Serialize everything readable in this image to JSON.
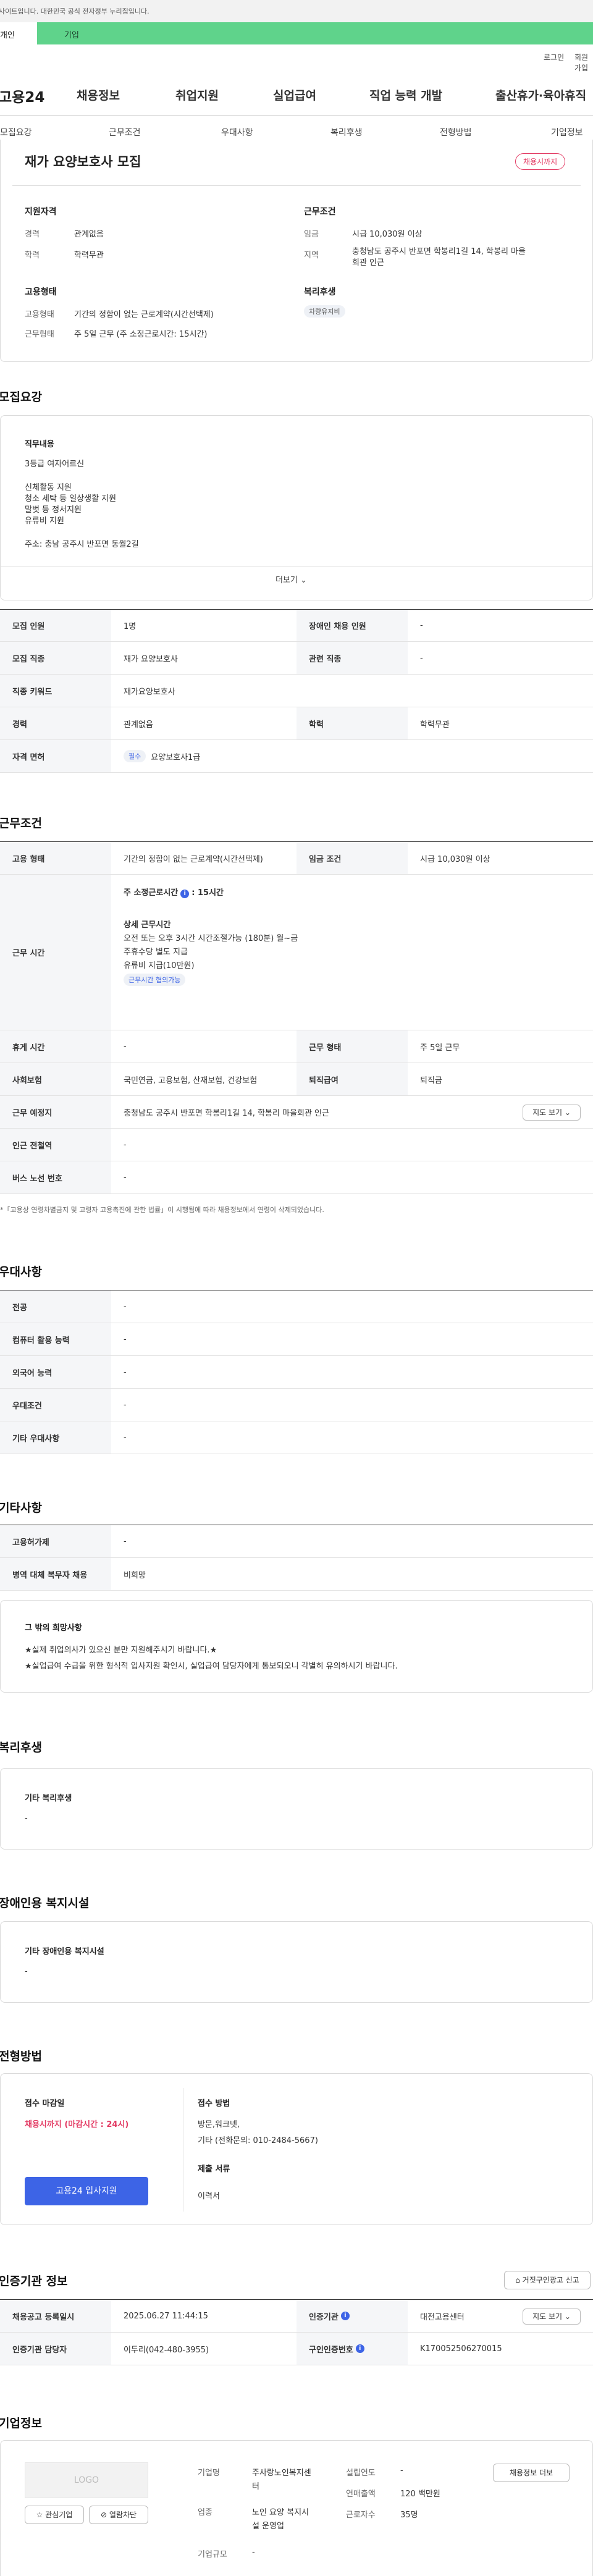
{
  "gov_notice": "사이트입니다. 대한민국 공식 전자정부 누리집입니다.",
  "tabs": {
    "personal": "개인",
    "corporate": "기업"
  },
  "util": {
    "login": "로그인",
    "signup": "회원가입"
  },
  "logo": "고용24",
  "gnb": [
    "채용정보",
    "취업지원",
    "실업급여",
    "직업 능력 개발",
    "출산휴가·육아휴직"
  ],
  "tabnav": [
    "모집요강",
    "근무조건",
    "우대사항",
    "복리후생",
    "전형방법",
    "기업정보"
  ],
  "summary": {
    "title": "재가 요양보호사 모집",
    "status_badge": "채용시까지",
    "qualification": {
      "heading": "지원자격",
      "career_label": "경력",
      "career_value": "관계없음",
      "edu_label": "학력",
      "edu_value": "학력무관"
    },
    "conditions": {
      "heading": "근무조건",
      "wage_label": "임금",
      "wage_value": "시급 10,030원 이상",
      "region_label": "지역",
      "region_value_1": "충청남도 공주시 반포면 학봉리1길 14, 학봉리 마을",
      "region_value_2": "회관 인근"
    },
    "employment": {
      "heading": "고용형태",
      "type_label": "고용형태",
      "type_value": "기간의 정함이 없는 근로계약(시간선택제)",
      "shift_label": "근무형태",
      "shift_value": "주 5일 근무 (주 소정근로시간: 15시간)"
    },
    "welfare": {
      "heading": "복리후생",
      "badge": "차량유지비"
    }
  },
  "recruit": {
    "section_title": "모집요강",
    "job_heading": "직무내용",
    "job_lines": [
      "3등급 여자어르신",
      "",
      "신체활동 지원",
      "청소 세탁 등 일상생활 지원",
      "말벗 등 정서지원",
      "유류비 지원",
      "",
      "주소: 충남 공주시 반포면 동월2길"
    ],
    "more_label": "더보기",
    "rows": [
      {
        "th1": "모집 인원",
        "td1": "1명",
        "th2": "장애인 채용 인원",
        "td2": "-"
      },
      {
        "th1": "모집 직종",
        "td1": "재가 요양보호사",
        "th2": "관련 직종",
        "td2": "-"
      },
      {
        "th1": "직종 키워드",
        "td1": "재가요양보호사"
      },
      {
        "th1": "경력",
        "td1": "관계없음",
        "th2": "학력",
        "td2": "학력무관"
      },
      {
        "th1": "자격 면허",
        "tag": "필수",
        "td1": "요양보호사1급"
      }
    ]
  },
  "conditions": {
    "section_title": "근무조건",
    "employ_type_th": "고용 형태",
    "employ_type_td": "기간의 정함이 없는 근로계약(시간선택제)",
    "wage_th": "임금 조건",
    "wage_td": "시급 10,030원 이상",
    "hours_th": "근무 시간",
    "hours_weekly": "주 소정근로시간",
    "hours_weekly_value": ": 15시간",
    "hours_detail_heading": "상세 근무시간",
    "hours_detail_lines": [
      "오전 또는 오후 3시간 시간조절가능 (180분) 월~금",
      "주휴수당 별도 지급",
      "유류비 지급(10만원)"
    ],
    "hours_tag": "근무시간 협의가능",
    "rows": [
      {
        "th1": "휴게 시간",
        "td1": "-",
        "th2": "근무 형태",
        "td2": "주 5일 근무"
      },
      {
        "th1": "사회보험",
        "td1": "국민연금, 고용보험, 산재보험, 건강보험",
        "th2": "퇴직급여",
        "td2": "퇴직금"
      },
      {
        "th1": "근무 예정지",
        "td1": "충청남도 공주시 반포면 학봉리1길 14, 학봉리 마을회관 인근",
        "btn": "지도 보기"
      },
      {
        "th1": "인근 전철역",
        "td1": "-"
      },
      {
        "th1": "버스 노선 번호",
        "td1": "-"
      }
    ],
    "footnote": "*「고용상 연령차별금지 및 고령자 고용촉진에 관한 법률」이 시행됨에 따라 채용정보에서 연령이 삭제되었습니다."
  },
  "preference": {
    "section_title": "우대사항",
    "rows": [
      {
        "th": "전공",
        "td": "-"
      },
      {
        "th": "컴퓨터 활용 능력",
        "td": "-"
      },
      {
        "th": "외국어 능력",
        "td": "-"
      },
      {
        "th": "우대조건",
        "td": "-"
      },
      {
        "th": "기타 우대사항",
        "td": "-"
      }
    ]
  },
  "etc": {
    "section_title": "기타사항",
    "rows": [
      {
        "th": "고용허가제",
        "td": "-"
      },
      {
        "th": "병역 대체 복무자 채용",
        "td": "비희망"
      }
    ],
    "box_heading": "그 밖의 희망사항",
    "box_lines": [
      "★실제 취업의사가 있으신 분만 지원해주시기 바랍니다.★",
      "★실업급여 수급을 위한 형식적 입사지원 확인시, 실업급여 담당자에게 통보되오니 각별히 유의하시기 바랍니다."
    ]
  },
  "welfare": {
    "section_title": "복리후생",
    "heading": "기타 복리후생",
    "value": "-"
  },
  "disability": {
    "section_title": "장애인용 복지시설",
    "heading": "기타 장애인용 복지시설",
    "value": "-"
  },
  "selection": {
    "section_title": "전형방법",
    "deadline_heading": "접수 마감일",
    "deadline_value": "채용시까지 (마감시간 : 24시)",
    "apply_button": "고용24 입사지원",
    "method_heading": "접수 방법",
    "method_lines": [
      "방문,워크넷,",
      "기타 (전화문의: 010-2484-5667)"
    ],
    "docs_heading": "제출 서류",
    "docs_value": "이력서"
  },
  "cert": {
    "section_title": "인증기관 정보",
    "report_button": "거짓구인광고 신고",
    "rows": [
      {
        "th1": "채용공고 등록일시",
        "td1": "2025.06.27 11:44:15",
        "th2": "인증기관",
        "td2": "대전고용센터",
        "btn": "지도 보기"
      },
      {
        "th1": "인증기관 담당자",
        "td1": "이두리(042-480-3955)",
        "th2": "구인인증번호",
        "td2": "K170052506270015"
      }
    ]
  },
  "company": {
    "section_title": "기업정보",
    "logo_text": "LOGO",
    "interest_button": "관심기업",
    "block_button": "열람차단",
    "name_label": "기업명",
    "name_value_1": "주사랑노인복지센",
    "name_value_2": "터",
    "industry_label": "업종",
    "industry_value_1": "노인 요양 복지시",
    "industry_value_2": "설 운영업",
    "size_label": "기업규모",
    "size_value": "-",
    "founded_label": "설립연도",
    "founded_value": "-",
    "revenue_label": "연매출액",
    "revenue_value": "120 백만원",
    "employees_label": "근로자수",
    "employees_value": "35명",
    "jobs_button": "채용정보 더보"
  }
}
